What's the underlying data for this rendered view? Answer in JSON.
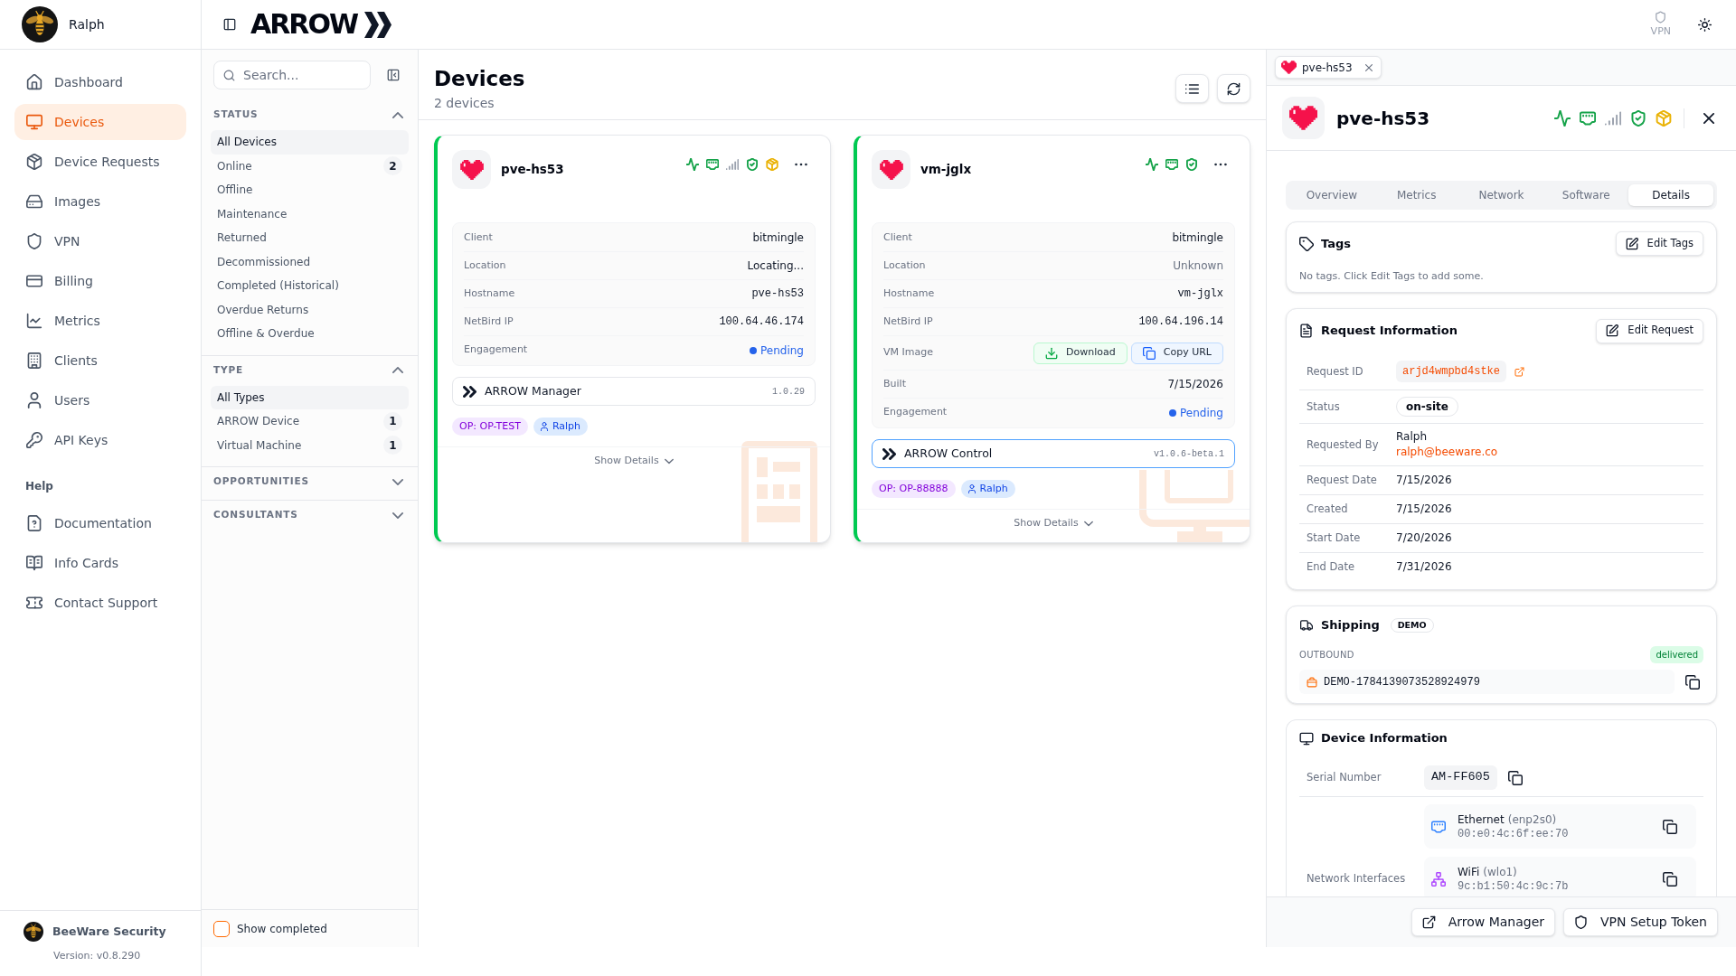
{
  "user": {
    "name": "Ralph"
  },
  "app": {
    "logo_text": "ARROW",
    "vpn_label": "VPN"
  },
  "nav": {
    "items": [
      {
        "label": "Dashboard",
        "selected": false
      },
      {
        "label": "Devices",
        "selected": true
      },
      {
        "label": "Device Requests",
        "selected": false
      },
      {
        "label": "Images",
        "selected": false
      },
      {
        "label": "VPN",
        "selected": false
      },
      {
        "label": "Billing",
        "selected": false
      },
      {
        "label": "Metrics",
        "selected": false
      },
      {
        "label": "Clients",
        "selected": false
      },
      {
        "label": "Users",
        "selected": false
      },
      {
        "label": "API Keys",
        "selected": false
      }
    ],
    "help_heading": "Help",
    "help_items": [
      {
        "label": "Documentation",
        "selected": false
      },
      {
        "label": "Info Cards",
        "selected": false
      },
      {
        "label": "Contact Support",
        "selected": false
      }
    ]
  },
  "organization": {
    "name": "BeeWare Security",
    "version": "Version: v0.8.290"
  },
  "filters": {
    "search": {
      "placeholder": "Search..."
    },
    "groups": [
      {
        "title": "STATUS",
        "expanded": true,
        "items": [
          {
            "label": "All Devices",
            "selected": true
          },
          {
            "label": "Online",
            "selected": false,
            "count": "2"
          },
          {
            "label": "Offline",
            "selected": false
          },
          {
            "label": "Maintenance",
            "selected": false
          },
          {
            "label": "Returned",
            "selected": false
          },
          {
            "label": "Decommissioned",
            "selected": false
          },
          {
            "label": "Completed (Historical)",
            "selected": false
          },
          {
            "label": "Overdue Returns",
            "selected": false
          },
          {
            "label": "Offline & Overdue",
            "selected": false
          }
        ]
      },
      {
        "title": "TYPE",
        "expanded": true,
        "items": [
          {
            "label": "All Types",
            "selected": true
          },
          {
            "label": "ARROW Device",
            "selected": false,
            "count": "1"
          },
          {
            "label": "Virtual Machine",
            "selected": false,
            "count": "1"
          }
        ]
      },
      {
        "title": "OPPORTUNITIES",
        "expanded": false
      },
      {
        "title": "CONSULTANTS",
        "expanded": false
      }
    ],
    "show_completed": {
      "label": "Show completed",
      "checked": false
    }
  },
  "devices": {
    "title": "Devices",
    "subtitle": "2 devices",
    "cards": [
      {
        "kind": "arrow_device",
        "name": "pve-hs53",
        "online": true,
        "indicators": [
          {
            "kind": "health",
            "color": "#16a34a"
          },
          {
            "kind": "ethernet",
            "color": "#16a34a"
          },
          {
            "kind": "wifi",
            "color": "#9ca3af"
          },
          {
            "kind": "vpn",
            "color": "#16a34a"
          },
          {
            "kind": "software",
            "color": "#eab308"
          }
        ],
        "rows": [
          {
            "kind": "text",
            "label": "Client",
            "value": "bitmingle"
          },
          {
            "kind": "text",
            "label": "Location",
            "value": "Locating..."
          },
          {
            "kind": "mono",
            "label": "Hostname",
            "value": "pve-hs53"
          },
          {
            "kind": "mono",
            "label": "NetBird IP",
            "value": "100.64.46.174"
          },
          {
            "kind": "status",
            "label": "Engagement",
            "value": "Pending",
            "color": "#2563eb"
          }
        ],
        "app": {
          "name": "ARROW Manager",
          "version": "1.0.29",
          "highlighted": false
        },
        "tags": [
          {
            "kind": "opportunity",
            "text": "OP: OP-TEST"
          },
          {
            "kind": "user",
            "text": "Ralph"
          }
        ],
        "details_toggle": "Show Details"
      },
      {
        "kind": "virtual_machine",
        "name": "vm-jglx",
        "online": true,
        "indicators": [
          {
            "kind": "health",
            "color": "#16a34a"
          },
          {
            "kind": "ethernet",
            "color": "#16a34a"
          },
          {
            "kind": "vpn",
            "color": "#16a34a"
          }
        ],
        "rows": [
          {
            "kind": "text",
            "label": "Client",
            "value": "bitmingle"
          },
          {
            "kind": "muted",
            "label": "Location",
            "value": "Unknown"
          },
          {
            "kind": "mono",
            "label": "Hostname",
            "value": "vm-jglx"
          },
          {
            "kind": "mono",
            "label": "NetBird IP",
            "value": "100.64.196.14"
          },
          {
            "kind": "actions",
            "label": "VM Image",
            "actions": [
              {
                "kind": "download",
                "label": "Download"
              },
              {
                "kind": "copy",
                "label": "Copy URL"
              }
            ]
          },
          {
            "kind": "text",
            "label": "Built",
            "value": "7/15/2026"
          },
          {
            "kind": "status",
            "label": "Engagement",
            "value": "Pending",
            "color": "#2563eb"
          }
        ],
        "app": {
          "name": "ARROW Control",
          "version": "v1.0.6-beta.1",
          "highlighted": true
        },
        "tags": [
          {
            "kind": "opportunity",
            "text": "OP: OP-88888"
          },
          {
            "kind": "user",
            "text": "Ralph"
          }
        ],
        "details_toggle": "Show Details"
      }
    ]
  },
  "detail": {
    "open_tabs": [
      {
        "label": "pve-hs53",
        "selected": true
      }
    ],
    "name": "pve-hs53",
    "indicators": [
      {
        "kind": "health",
        "color": "#16a34a"
      },
      {
        "kind": "ethernet",
        "color": "#16a34a"
      },
      {
        "kind": "wifi",
        "color": "#9ca3af"
      },
      {
        "kind": "vpn",
        "color": "#16a34a"
      },
      {
        "kind": "software",
        "color": "#eab308"
      }
    ],
    "tabs": [
      {
        "label": "Overview",
        "selected": false
      },
      {
        "label": "Metrics",
        "selected": false
      },
      {
        "label": "Network",
        "selected": false
      },
      {
        "label": "Software",
        "selected": false
      },
      {
        "label": "Details",
        "selected": true
      }
    ],
    "tags": {
      "title": "Tags",
      "button": "Edit Tags",
      "empty_text": "No tags. Click Edit Tags to add some."
    },
    "request": {
      "title": "Request Information",
      "button": "Edit Request",
      "rows": [
        {
          "kind": "code_link",
          "label": "Request ID",
          "value": "arjd4wmpbd4stke"
        },
        {
          "kind": "pill",
          "label": "Status",
          "value": "on-site"
        },
        {
          "kind": "person",
          "label": "Requested By",
          "value": "Ralph",
          "email": "ralph@beeware.co"
        },
        {
          "kind": "text",
          "label": "Request Date",
          "value": "7/15/2026"
        },
        {
          "kind": "text",
          "label": "Created",
          "value": "7/15/2026"
        },
        {
          "kind": "text",
          "label": "Start Date",
          "value": "7/20/2026"
        },
        {
          "kind": "text",
          "label": "End Date",
          "value": "7/31/2026"
        }
      ]
    },
    "shipping": {
      "title": "Shipping",
      "badge": "DEMO",
      "direction": "OUTBOUND",
      "status": "delivered",
      "tracking": "DEMO-1784139073528924979"
    },
    "device_info": {
      "title": "Device Information",
      "rows": [
        {
          "kind": "serial",
          "label": "Serial Number",
          "value": "AM-FF605"
        },
        {
          "kind": "interfaces",
          "label": "Network Interfaces",
          "interfaces": [
            {
              "kind": "ethernet",
              "name": "Ethernet",
              "device": "(enp2s0)",
              "mac": "00:e0:4c:6f:ee:70"
            },
            {
              "kind": "wifi",
              "name": "WiFi",
              "device": "(wlo1)",
              "mac": "9c:b1:50:4c:9c:7b"
            }
          ]
        }
      ]
    },
    "footer_buttons": [
      {
        "kind": "external",
        "label": "Arrow Manager"
      },
      {
        "kind": "vpn",
        "label": "VPN Setup Token"
      }
    ]
  }
}
